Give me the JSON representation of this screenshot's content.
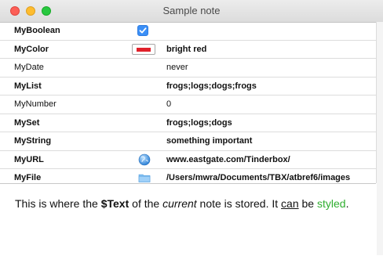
{
  "window": {
    "title": "Sample note"
  },
  "attributes": [
    {
      "name": "MyBoolean",
      "control": "checkbox",
      "value": ""
    },
    {
      "name": "MyColor",
      "control": "swatch",
      "value": "bright red"
    },
    {
      "name": "MyDate",
      "control": "",
      "value": "never"
    },
    {
      "name": "MyList",
      "control": "",
      "value": "frogs;logs;dogs;frogs"
    },
    {
      "name": "MyNumber",
      "control": "",
      "value": "0"
    },
    {
      "name": "MySet",
      "control": "",
      "value": "frogs;logs;dogs"
    },
    {
      "name": "MyString",
      "control": "",
      "value": "something important"
    },
    {
      "name": "MyURL",
      "control": "globe-icon",
      "value": "www.eastgate.com/Tinderbox/"
    },
    {
      "name": "MyFile",
      "control": "folder-icon",
      "value": "/Users/mwra/Documents/TBX/atbref6/images"
    }
  ],
  "text": {
    "p1": "This is where the ",
    "p2": "$Text",
    "p3": " of the ",
    "p4": "current",
    "p5": " note is stored. It ",
    "p6": "can",
    "p7": " be ",
    "p8": "styled",
    "p9": "."
  },
  "colors": {
    "swatch": "#e0202a",
    "checkbox": "#3b8ff6",
    "styled_text": "#2fae2f"
  }
}
